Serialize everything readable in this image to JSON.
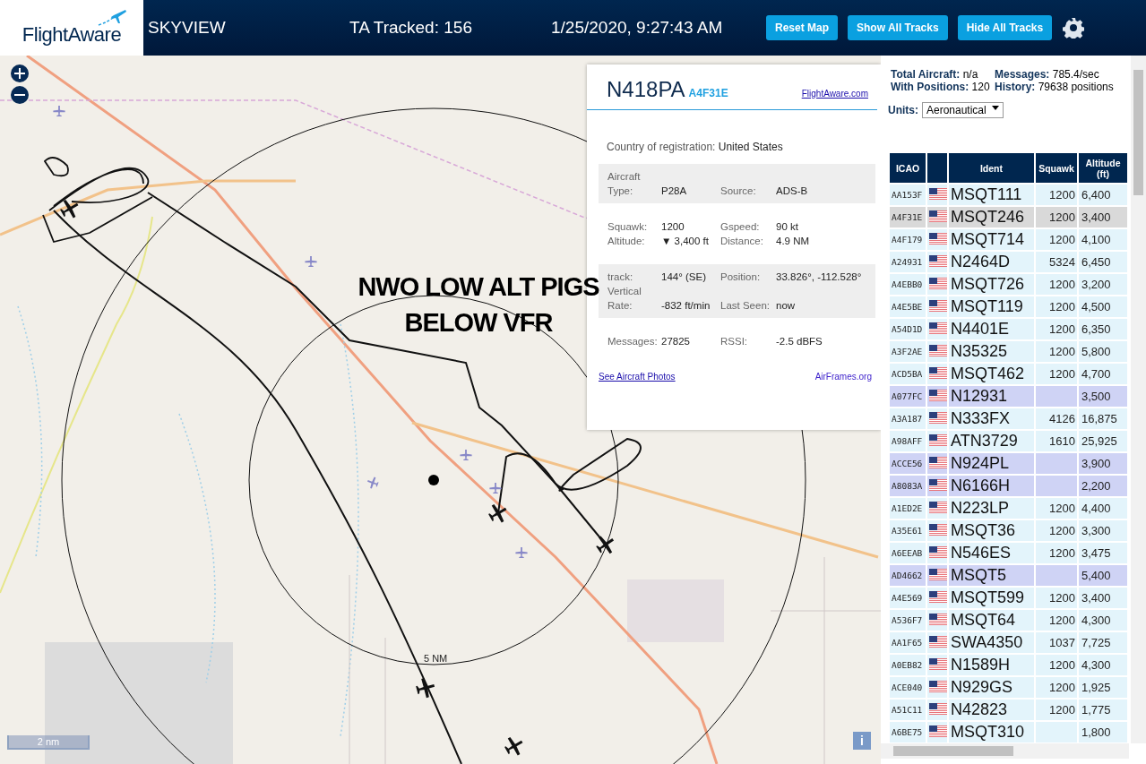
{
  "header": {
    "logo": "FlightAware",
    "title": "SKYVIEW",
    "tracked": "TA Tracked: 156",
    "datetime": "1/25/2020, 9:27:43 AM",
    "buttons": [
      "Reset Map",
      "Show All Tracks",
      "Hide All Tracks"
    ]
  },
  "map": {
    "annotation": [
      "NWO LOW ALT PIGS",
      "BELOW VFR"
    ],
    "ring_label": "5 NM",
    "scale": "2 nm",
    "info": "i"
  },
  "popup": {
    "ident": "N418PA",
    "hex": "A4F31E",
    "link": "FlightAware.com",
    "country_label": "Country of registration:",
    "country": "United States",
    "groups": [
      {
        "shaded": true,
        "items": [
          {
            "label": "Aircraft Type:",
            "value": "P28A"
          },
          {
            "label": "Source:",
            "value": "ADS-B"
          }
        ]
      },
      {
        "shaded": false,
        "items": [
          {
            "label": "Squawk:",
            "value": "1200"
          },
          {
            "label": "Gspeed:",
            "value": "90 kt"
          },
          {
            "label": "Altitude:",
            "value": "▼ 3,400 ft"
          },
          {
            "label": "Distance:",
            "value": "4.9 NM"
          }
        ]
      },
      {
        "shaded": true,
        "items": [
          {
            "label": "track:",
            "value": "144° (SE)"
          },
          {
            "label": "Position:",
            "value": "33.826°, -112.528°"
          },
          {
            "label": "Vertical Rate:",
            "value": "-832 ft/min"
          },
          {
            "label": "Last Seen:",
            "value": "now"
          }
        ]
      },
      {
        "shaded": false,
        "items": [
          {
            "label": "Messages:",
            "value": "27825"
          },
          {
            "label": "RSSI:",
            "value": "-2.5 dBFS"
          }
        ]
      }
    ],
    "photos_link": "See Aircraft Photos",
    "airframes_link": "AirFrames.org"
  },
  "stats": [
    {
      "label": "Total Aircraft:",
      "value": "n/a"
    },
    {
      "label": "Messages:",
      "value": "785.4/sec"
    },
    {
      "label": "With Positions:",
      "value": "120"
    },
    {
      "label": "History:",
      "value": "79638 positions"
    }
  ],
  "units": {
    "label": "Units:",
    "value": "Aeronautical"
  },
  "table": {
    "columns": [
      "ICAO",
      "",
      "Ident",
      "Squawk",
      "Altitude (ft)"
    ],
    "rows": [
      {
        "icao": "AA153F",
        "ident": "MSQT111",
        "squawk": "1200",
        "altitude": "6,400",
        "kind": "adsb",
        "selected": false
      },
      {
        "icao": "A4F31E",
        "ident": "MSQT246",
        "squawk": "1200",
        "altitude": "3,400",
        "kind": "adsb",
        "selected": true
      },
      {
        "icao": "A4F179",
        "ident": "MSQT714",
        "squawk": "1200",
        "altitude": "4,100",
        "kind": "adsb",
        "selected": false
      },
      {
        "icao": "A24931",
        "ident": "N2464D",
        "squawk": "5324",
        "altitude": "6,450",
        "kind": "adsb",
        "selected": false
      },
      {
        "icao": "A4EBB0",
        "ident": "MSQT726",
        "squawk": "1200",
        "altitude": "3,200",
        "kind": "adsb",
        "selected": false
      },
      {
        "icao": "A4E5BE",
        "ident": "MSQT119",
        "squawk": "1200",
        "altitude": "4,500",
        "kind": "adsb",
        "selected": false
      },
      {
        "icao": "A54D1D",
        "ident": "N4401E",
        "squawk": "1200",
        "altitude": "6,350",
        "kind": "adsb",
        "selected": false
      },
      {
        "icao": "A3F2AE",
        "ident": "N35325",
        "squawk": "1200",
        "altitude": "5,800",
        "kind": "adsb",
        "selected": false
      },
      {
        "icao": "ACD5BA",
        "ident": "MSQT462",
        "squawk": "1200",
        "altitude": "4,700",
        "kind": "adsb",
        "selected": false
      },
      {
        "icao": "A077FC",
        "ident": "N12931",
        "altitude": "3,500",
        "kind": "tisb",
        "selected": false
      },
      {
        "icao": "A3A187",
        "ident": "N333FX",
        "squawk": "4126",
        "altitude": "16,875",
        "kind": "adsb",
        "selected": false
      },
      {
        "icao": "A98AFF",
        "ident": "ATN3729",
        "squawk": "1610",
        "altitude": "25,925",
        "kind": "adsb",
        "selected": false
      },
      {
        "icao": "ACCE56",
        "ident": "N924PL",
        "altitude": "3,900",
        "kind": "tisb",
        "selected": false
      },
      {
        "icao": "A8083A",
        "ident": "N6166H",
        "altitude": "2,200",
        "kind": "tisb",
        "selected": false
      },
      {
        "icao": "A1ED2E",
        "ident": "N223LP",
        "squawk": "1200",
        "altitude": "4,400",
        "kind": "adsb",
        "selected": false
      },
      {
        "icao": "A35E61",
        "ident": "MSQT36",
        "squawk": "1200",
        "altitude": "3,300",
        "kind": "adsb",
        "selected": false
      },
      {
        "icao": "A6EEAB",
        "ident": "N546ES",
        "squawk": "1200",
        "altitude": "3,475",
        "kind": "adsb",
        "selected": false
      },
      {
        "icao": "AD4662",
        "ident": "MSQT5",
        "altitude": "5,400",
        "kind": "tisb",
        "selected": false
      },
      {
        "icao": "A4E569",
        "ident": "MSQT599",
        "squawk": "1200",
        "altitude": "3,400",
        "kind": "adsb",
        "selected": false
      },
      {
        "icao": "A536F7",
        "ident": "MSQT64",
        "squawk": "1200",
        "altitude": "4,300",
        "kind": "adsb",
        "selected": false
      },
      {
        "icao": "AA1F65",
        "ident": "SWA4350",
        "squawk": "1037",
        "altitude": "7,725",
        "kind": "adsb",
        "selected": false
      },
      {
        "icao": "A0EB82",
        "ident": "N1589H",
        "squawk": "1200",
        "altitude": "4,300",
        "kind": "adsb",
        "selected": false
      },
      {
        "icao": "ACE040",
        "ident": "N929GS",
        "squawk": "1200",
        "altitude": "1,925",
        "kind": "adsb",
        "selected": false
      },
      {
        "icao": "A51C11",
        "ident": "N42823",
        "squawk": "1200",
        "altitude": "1,775",
        "kind": "adsb",
        "selected": false
      },
      {
        "icao": "A6BE75",
        "ident": "MSQT310",
        "altitude": "1,800",
        "kind": "adsb",
        "selected": false
      }
    ]
  }
}
